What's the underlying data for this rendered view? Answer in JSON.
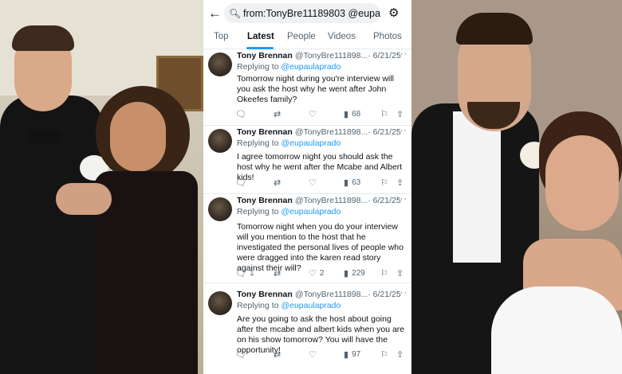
{
  "header": {
    "back_icon": "arrow-left-icon",
    "search_query": "from:TonyBre11189803 @eupa...",
    "filter_icon": "sliders-icon"
  },
  "tabs": [
    {
      "label": "Top"
    },
    {
      "label": "Latest",
      "active": true
    },
    {
      "label": "People"
    },
    {
      "label": "Videos"
    },
    {
      "label": "Photos"
    }
  ],
  "tweets": [
    {
      "name": "Tony Brennan",
      "handle": "@TonyBre111898...",
      "date": "· 6/21/25",
      "replying_to": "@eupaulaprado",
      "text": "Tomorrow night during you're interview will you ask the host why he went after John Okeefes family?",
      "replies": "",
      "retweets": "",
      "likes": "",
      "views": "68"
    },
    {
      "name": "Tony Brennan",
      "handle": "@TonyBre111898...",
      "date": "· 6/21/25",
      "replying_to": "@eupaulaprado",
      "text": "I agree tomorrow night you should ask the host why he went after the Mcabe and Albert kids!",
      "replies": "",
      "retweets": "",
      "likes": "",
      "views": "63"
    },
    {
      "name": "Tony Brennan",
      "handle": "@TonyBre111898...",
      "date": "· 6/21/25",
      "replying_to": "@eupaulaprado",
      "text": "Tomorrow night when you do your interview will you mention to the host that he investigated the personal lives of people who were dragged into the karen read story against their will?",
      "replies": "1",
      "retweets": "",
      "likes": "2",
      "views": "229"
    },
    {
      "name": "Tony Brennan",
      "handle": "@TonyBre111898...",
      "date": "· 6/21/25",
      "replying_to": "@eupaulaprado",
      "text": "Are you going to ask the host about going after the mcabe and albert kids when you are on his show tomorrow? You will have the opportunity!",
      "replies": "",
      "retweets": "",
      "likes": "",
      "views": "97"
    }
  ],
  "labels": {
    "replying_prefix": "Replying to",
    "more": "···"
  },
  "colors": {
    "accent": "#1d9bf0",
    "text": "#0f1419",
    "muted": "#536471"
  }
}
